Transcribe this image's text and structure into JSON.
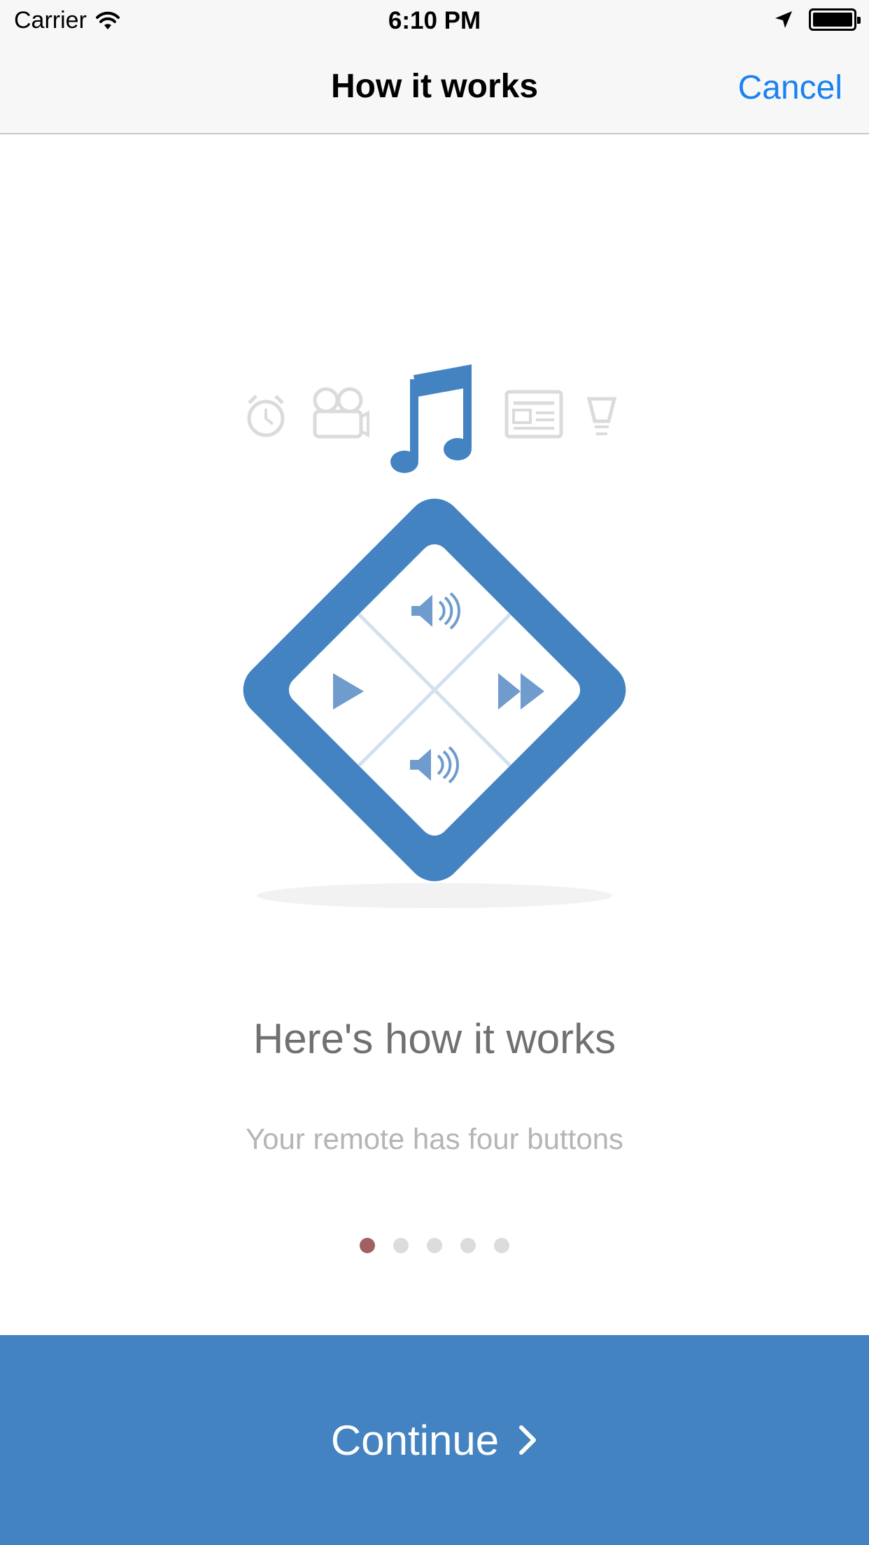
{
  "status_bar": {
    "carrier": "Carrier",
    "time": "6:10 PM"
  },
  "nav": {
    "title": "How it works",
    "cancel_label": "Cancel"
  },
  "illustration": {
    "category_icons": [
      "alarm-clock-icon",
      "movie-camera-icon",
      "music-note-icon",
      "news-icon",
      "light-bulb-icon"
    ],
    "selected_category": "music-note-icon",
    "remote_buttons": [
      "volume-up-icon",
      "play-icon",
      "fast-forward-icon",
      "volume-down-icon"
    ],
    "accent_color": "#4483c1"
  },
  "content": {
    "heading": "Here's how it works",
    "subheading": "Your remote has four buttons"
  },
  "pagination": {
    "current_page": 1,
    "total_pages": 5
  },
  "footer": {
    "continue_label": "Continue"
  }
}
